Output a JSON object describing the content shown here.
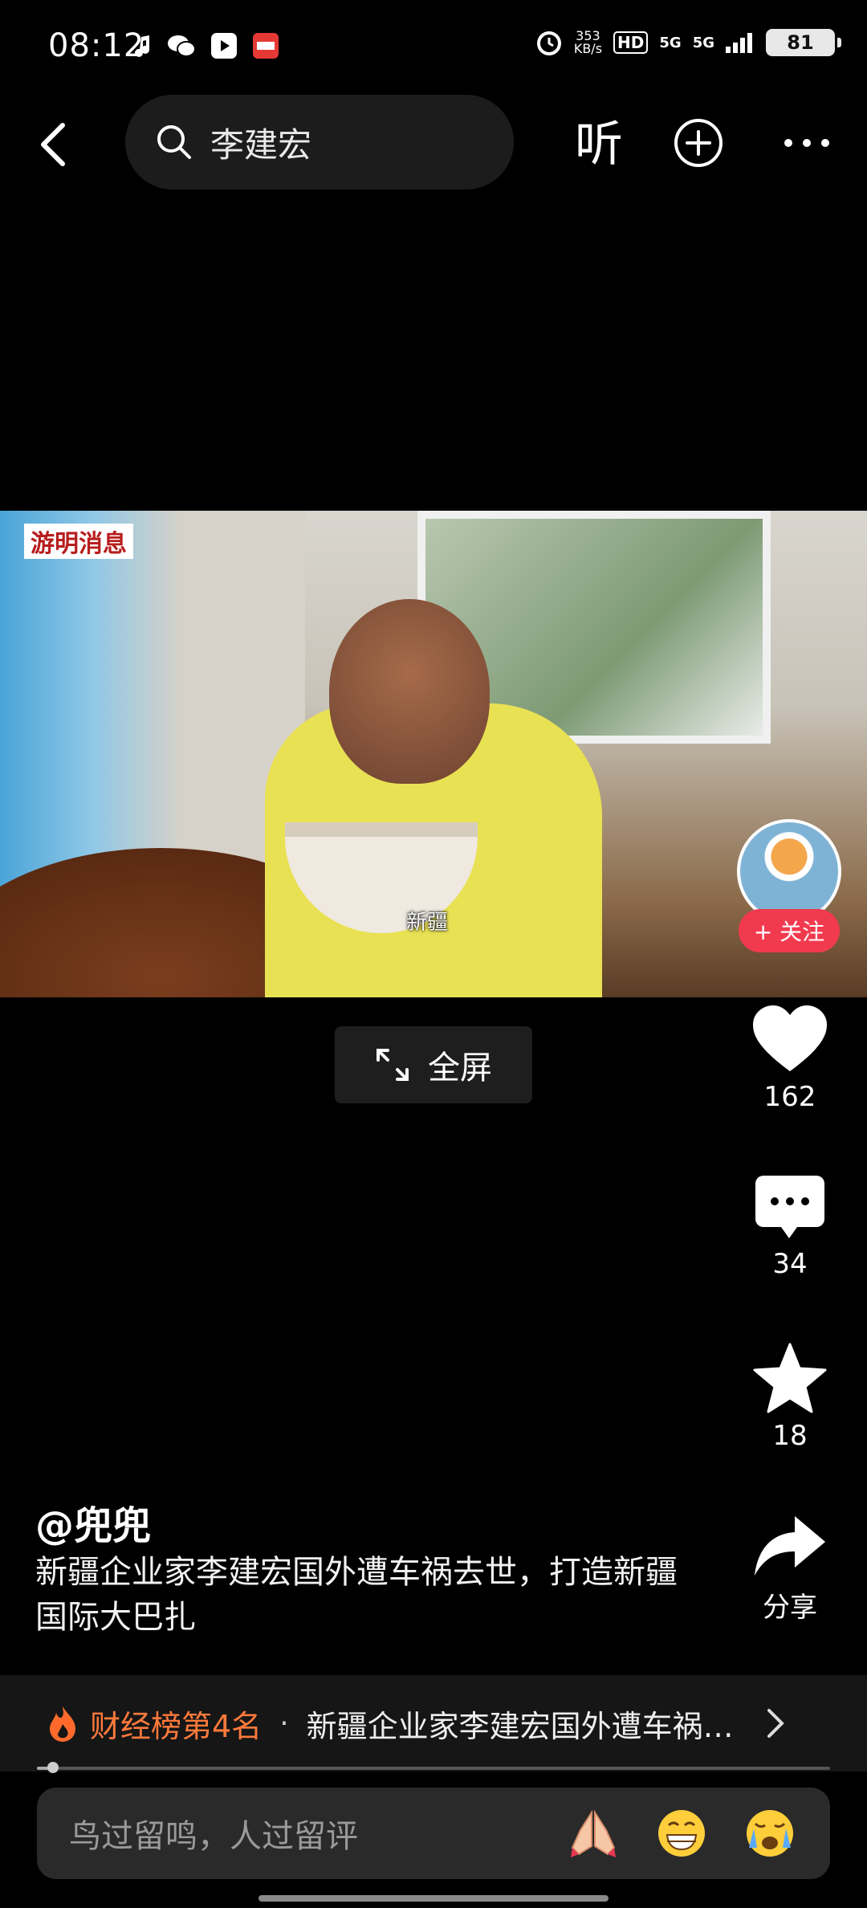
{
  "status_bar": {
    "time": "08:12",
    "net_speed_value": "353",
    "net_speed_unit": "KB/s",
    "hd_label": "HD",
    "signal_1": "5G",
    "signal_2": "5G",
    "battery": "81"
  },
  "nav": {
    "search_query": "李建宏",
    "listen_label": "听"
  },
  "video": {
    "watermark": "游明消息",
    "caption": "新疆",
    "fullscreen_label": "全屏"
  },
  "follow": {
    "label": "+ 关注"
  },
  "actions": {
    "likes": "162",
    "comments": "34",
    "favorites": "18",
    "share_label": "分享"
  },
  "post": {
    "author": "@兜兜",
    "description": "新疆企业家李建宏国外遭车祸去世，打造新疆国际大巴扎"
  },
  "rank": {
    "label": "财经榜第4名",
    "separator": "·",
    "title": "新疆企业家李建宏国外遭车祸去世…"
  },
  "progress": {
    "fraction": 0.02
  },
  "comment": {
    "placeholder": "鸟过留鸣，人过留评"
  },
  "colors": {
    "accent_follow": "#f23a4f",
    "rank_label": "#ff7a3c"
  },
  "icons": [
    "back-icon",
    "search-icon",
    "plus-circle-icon",
    "more-icon",
    "fullscreen-icon",
    "heart-icon",
    "comment-icon",
    "star-icon",
    "share-icon",
    "fire-icon",
    "chevron-right-icon",
    "pray-emoji-icon",
    "grin-emoji-icon",
    "cry-emoji-icon"
  ]
}
